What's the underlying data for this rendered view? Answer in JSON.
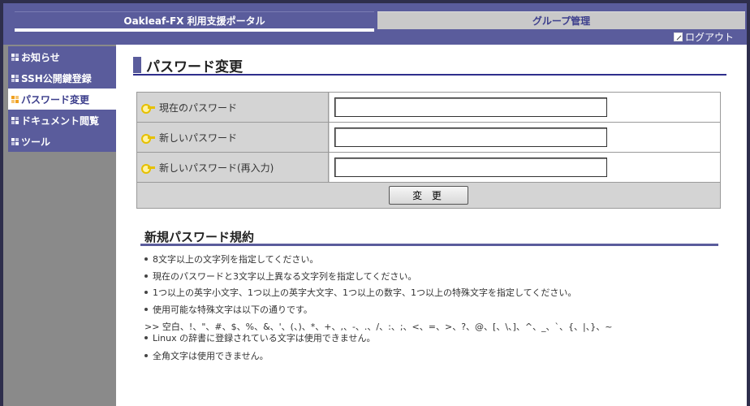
{
  "header": {
    "tabs": [
      {
        "label": "Oakleaf-FX 利用支援ポータル"
      },
      {
        "label": "グループ管理"
      }
    ],
    "logout_label": "ログアウト"
  },
  "sidebar": {
    "items": [
      {
        "label": "お知らせ"
      },
      {
        "label": "SSH公開鍵登録"
      },
      {
        "label": "パスワード変更"
      },
      {
        "label": "ドキュメント閲覧"
      },
      {
        "label": "ツール"
      }
    ],
    "active": "パスワード変更"
  },
  "main": {
    "title": "パスワード変更",
    "form": {
      "fields": [
        {
          "label": "現在のパスワード",
          "value": ""
        },
        {
          "label": "新しいパスワード",
          "value": ""
        },
        {
          "label": "新しいパスワード(再入力)",
          "value": ""
        }
      ],
      "submit_label": "変 更"
    },
    "rules": {
      "heading": "新規パスワード規約",
      "items": [
        "8文字以上の文字列を指定してください。",
        "現在のパスワードと3文字以上異なる文字列を指定してください。",
        "1つ以上の英字小文字、1つ以上の英字大文字、1つ以上の数字、1つ以上の特殊文字を指定してください。",
        "使用可能な特殊文字は以下の通りです。"
      ],
      "special_chars": ">> 空白、!、\"、#、$、%、&、'、(、)、*、+、,、-、.、/、:、;、<、=、>、?、@、[、\\、]、^、_、`、{、|、}、~",
      "items_after": [
        "Linux の辞書に登録されている文字は使用できません。",
        "全角文字は使用できません。"
      ]
    }
  },
  "colors": {
    "header_bg": "#5a5c9c",
    "sidebar_bg": "#8a8a8a",
    "accent": "#3c3e8c"
  }
}
